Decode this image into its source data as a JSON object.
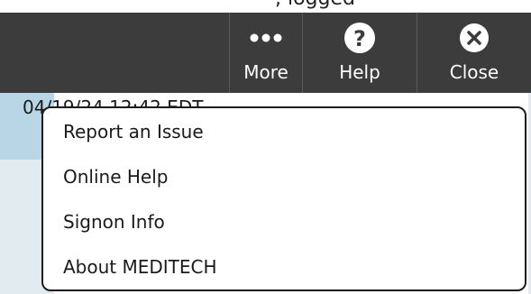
{
  "toolbar": {
    "buttons": [
      {
        "label": "More",
        "icon": "ellipsis-icon"
      },
      {
        "label": "Help",
        "icon": "help-icon"
      },
      {
        "label": "Close",
        "icon": "close-icon"
      }
    ]
  },
  "behind": {
    "row_text": "04/19/24 12:42 EDT"
  },
  "menu": {
    "items": [
      {
        "label": "Report an Issue"
      },
      {
        "label": "Online Help"
      },
      {
        "label": "Signon Info"
      },
      {
        "label": "About MEDITECH"
      }
    ]
  },
  "colors": {
    "toolbar_bg": "#3c3c3c",
    "highlight_row": "#b8d6e6",
    "panel_bg": "#e1ebf0"
  }
}
